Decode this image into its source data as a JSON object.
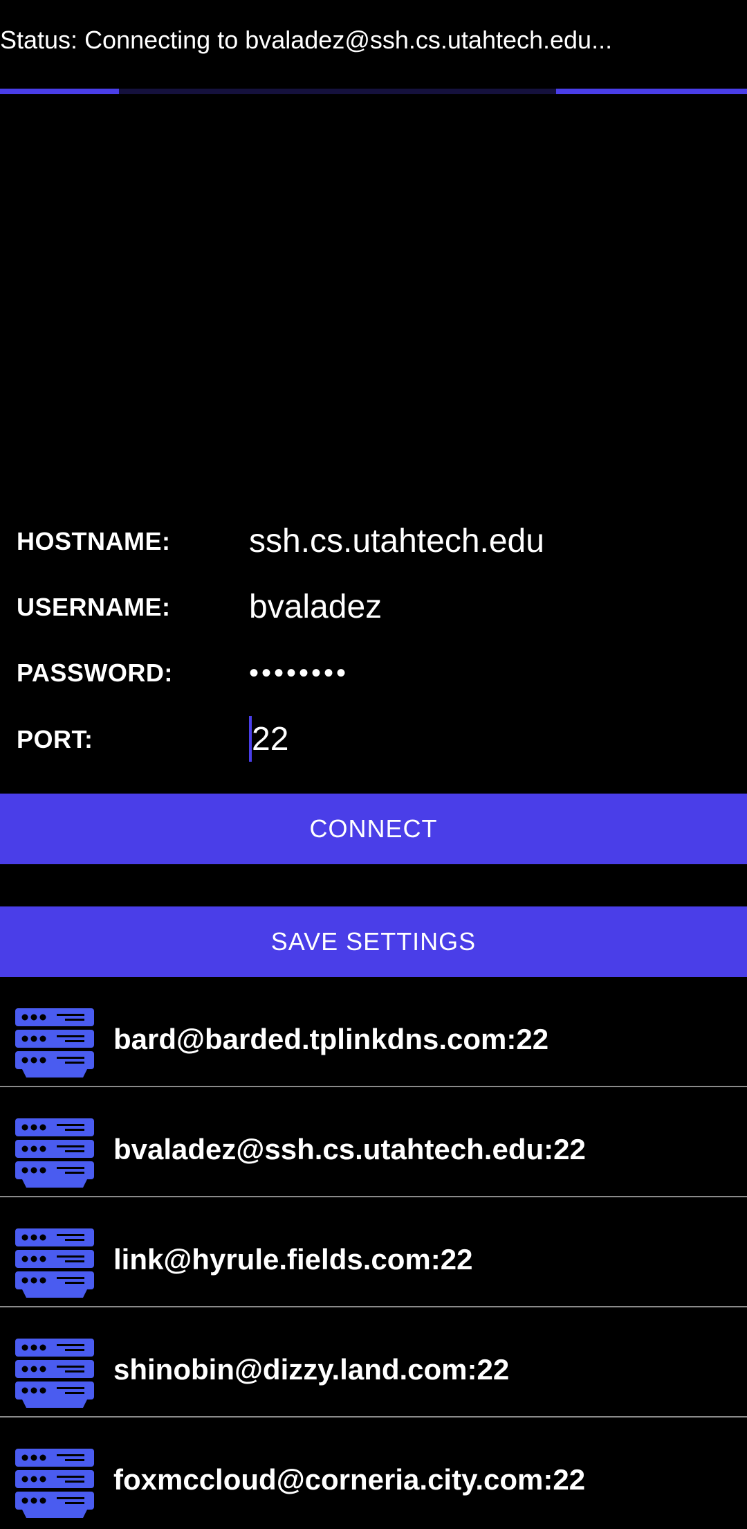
{
  "status": {
    "text": "Status: Connecting to bvaladez@ssh.cs.utahtech.edu..."
  },
  "progress": {
    "indeterminate": true,
    "color": "#4a3ee8",
    "track_color": "#15113d"
  },
  "form": {
    "hostname": {
      "label": "HOSTNAME:",
      "value": "ssh.cs.utahtech.edu"
    },
    "username": {
      "label": "USERNAME:",
      "value": "bvaladez"
    },
    "password": {
      "label": "PASSWORD:",
      "value": "••••••••"
    },
    "port": {
      "label": "PORT:",
      "value": "22"
    }
  },
  "buttons": {
    "connect_label": "CONNECT",
    "save_label": "SAVE SETTINGS"
  },
  "servers": [
    {
      "label": "bard@barded.tplinkdns.com:22",
      "icon": "server-icon"
    },
    {
      "label": "bvaladez@ssh.cs.utahtech.edu:22",
      "icon": "server-icon"
    },
    {
      "label": "link@hyrule.fields.com:22",
      "icon": "server-icon"
    },
    {
      "label": "shinobin@dizzy.land.com:22",
      "icon": "server-icon"
    },
    {
      "label": "foxmccloud@corneria.city.com:22",
      "icon": "server-icon"
    }
  ],
  "colors": {
    "accent": "#4a3ee8",
    "icon": "#4a5cf0",
    "background": "#000000",
    "divider": "#8a8a8a"
  }
}
